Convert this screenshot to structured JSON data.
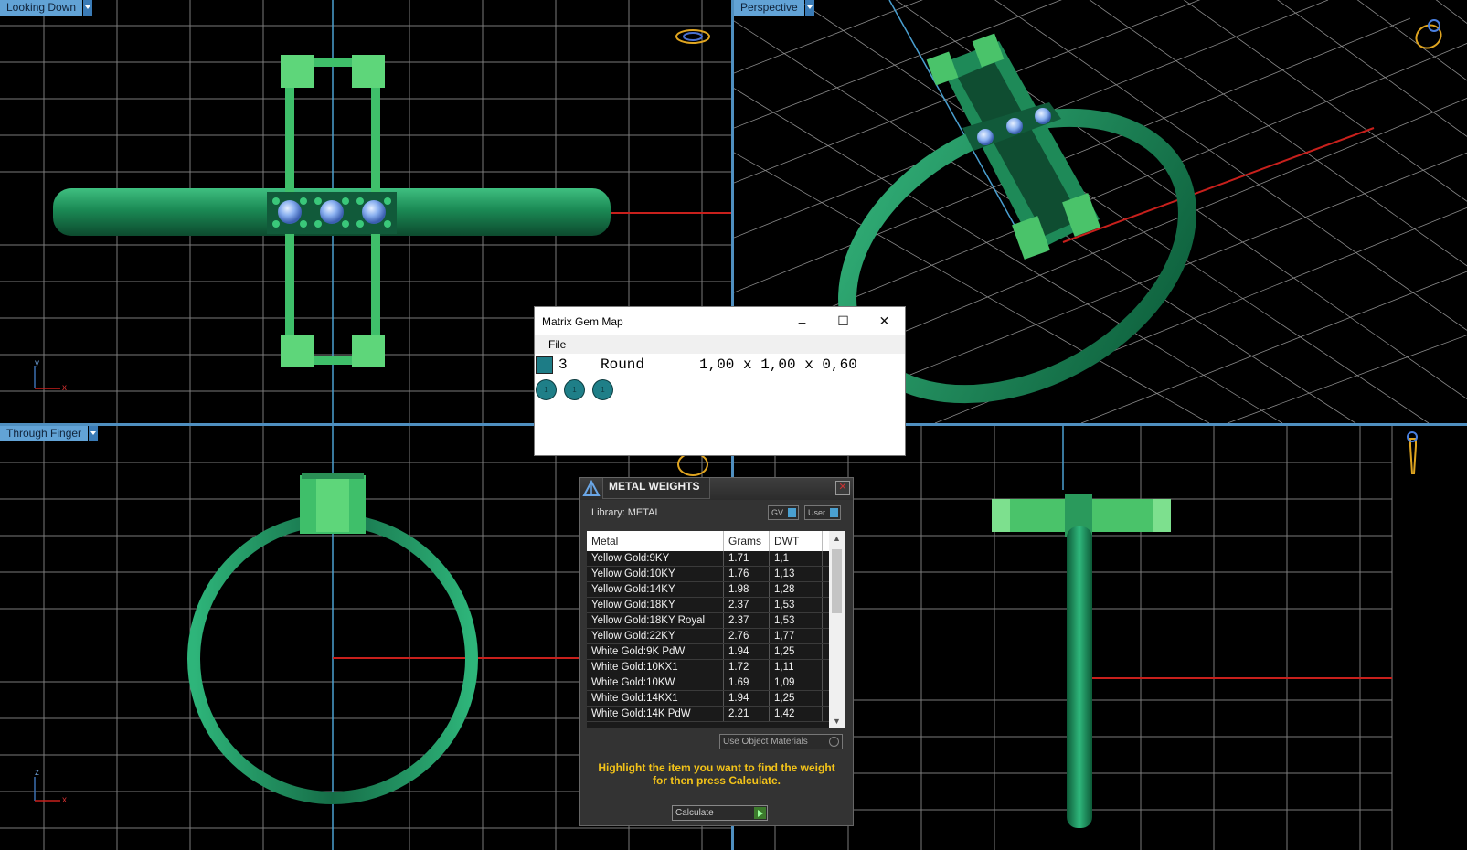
{
  "viewports": {
    "top_left": {
      "label": "Looking Down",
      "axis_x": "x",
      "axis_y": "y"
    },
    "top_right": {
      "label": "Perspective"
    },
    "bottom_left": {
      "label": "Through Finger",
      "axis_x": "x",
      "axis_y": "z"
    },
    "bottom_right": {
      "label": ""
    }
  },
  "gem_map": {
    "title": "Matrix Gem Map",
    "menu_file": "File",
    "row": {
      "count": "3",
      "shape": "Round",
      "size": "1,00 x 1,00 x 0,60"
    },
    "gem_labels": [
      "1",
      "1",
      "1"
    ],
    "swatch_color": "#1d7c86"
  },
  "metal_weights": {
    "title": "METAL WEIGHTS",
    "library": "Library: METAL",
    "toggle_gv": "GV",
    "toggle_user": "User",
    "columns": [
      "Metal",
      "Grams",
      "DWT"
    ],
    "rows": [
      [
        "Yellow Gold:9KY",
        "1.71",
        "1,1"
      ],
      [
        "Yellow Gold:10KY",
        "1.76",
        "1,13"
      ],
      [
        "Yellow Gold:14KY",
        "1.98",
        "1,28"
      ],
      [
        "Yellow Gold:18KY",
        "2.37",
        "1,53"
      ],
      [
        "Yellow Gold:18KY Royal",
        "2.37",
        "1,53"
      ],
      [
        "Yellow Gold:22KY",
        "2.76",
        "1,77"
      ],
      [
        "White Gold:9K PdW",
        "1.94",
        "1,25"
      ],
      [
        "White Gold:10KX1",
        "1.72",
        "1,11"
      ],
      [
        "White Gold:10KW",
        "1.69",
        "1,09"
      ],
      [
        "White Gold:14KX1",
        "1.94",
        "1,25"
      ],
      [
        "White Gold:14K PdW",
        "2.21",
        "1,42"
      ]
    ],
    "use_object_materials": "Use Object Materials",
    "hint": "Highlight the item you want to find the weight for then press Calculate.",
    "calculate_label": "Calculate",
    "hint_color": "#f3c319"
  },
  "colors": {
    "grid": "#8a8a8a",
    "metal": "#1e8a58",
    "prong": "#5ed67a",
    "gem": "#8ab4ff",
    "axis_red": "#c8201c",
    "axis_blue": "#4a9fd0"
  }
}
